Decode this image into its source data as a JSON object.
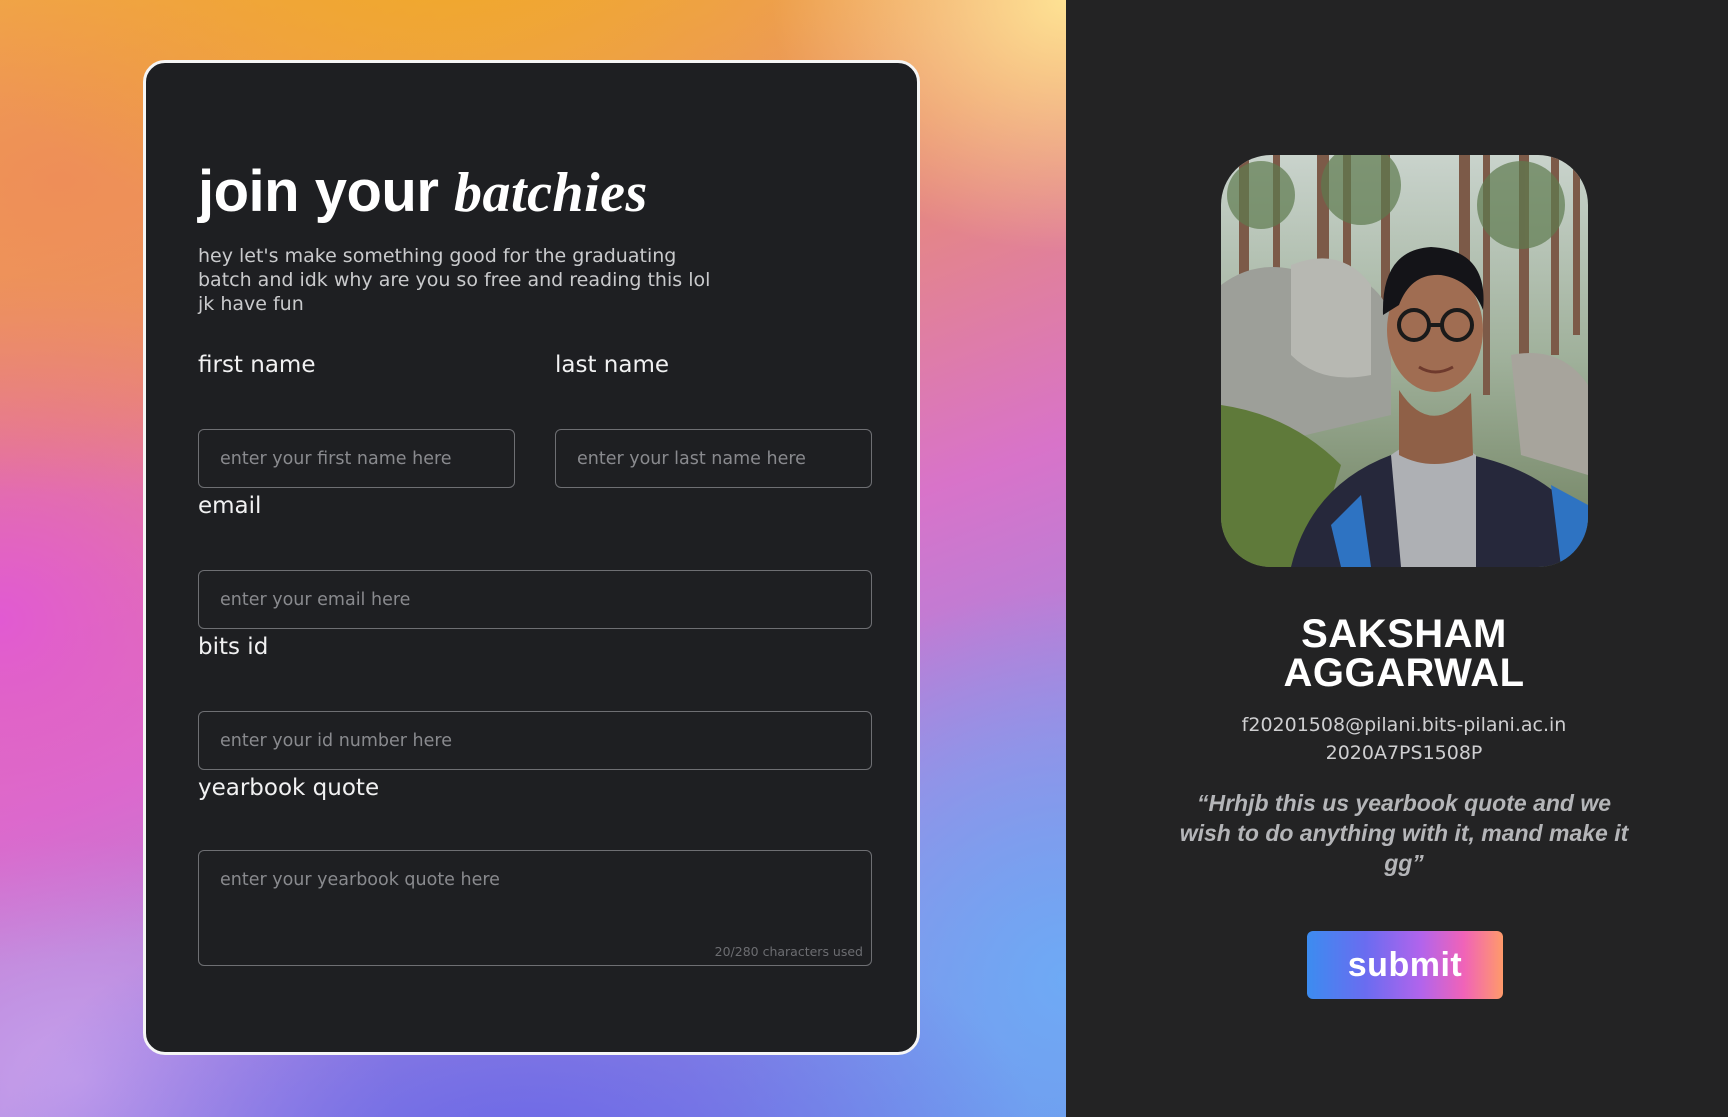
{
  "colors": {
    "card_background": "#1e1f22",
    "right_background": "#232324",
    "card_border": "#f5f5f5",
    "input_border": "#6e6f73",
    "placeholder": "#898a8e",
    "submit_gradient": [
      "#3c8cf0",
      "#6a6cf0",
      "#b164ec",
      "#f063b8",
      "#ff9a6a"
    ]
  },
  "form": {
    "title_plain": "join your",
    "title_accent": "batchies",
    "subtitle": "hey let's make something good for the graduating batch and idk why are you so free and reading this lol jk have fun",
    "first_name": {
      "label": "first name",
      "placeholder": "enter your first name here",
      "value": ""
    },
    "last_name": {
      "label": "last name",
      "placeholder": "enter your last name here",
      "value": ""
    },
    "email": {
      "label": "email",
      "placeholder": "enter your email here",
      "value": ""
    },
    "bits_id": {
      "label": "bits id",
      "placeholder": "enter your id number here",
      "value": ""
    },
    "yearbook_quote": {
      "label": "yearbook quote",
      "placeholder": "enter your yearbook quote here",
      "value": "",
      "char_count": "20/280 characters used"
    }
  },
  "preview": {
    "photo_icon": "profile-photo",
    "name_line1": "SAKSHAM",
    "name_line2": "AGGARWAL",
    "email": "f20201508@pilani.bits-pilani.ac.in",
    "bits_id": "2020A7PS1508P",
    "quote": "“Hrhjb this us yearbook quote and we wish to do anything with it, mand make it gg”"
  },
  "submit": {
    "label": "submit"
  }
}
